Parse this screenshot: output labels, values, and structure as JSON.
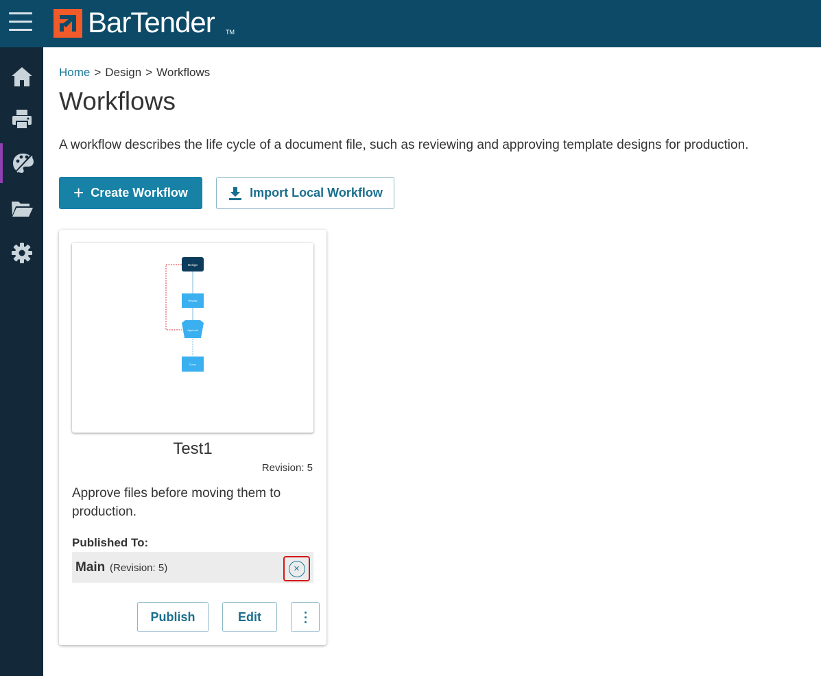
{
  "header": {
    "brand": "BarTender",
    "trademark": "TM",
    "menu_icon": "hamburger-menu-icon"
  },
  "sidebar": {
    "items": [
      {
        "icon": "home-icon",
        "active": false
      },
      {
        "icon": "printer-icon",
        "active": false
      },
      {
        "icon": "design-palette-icon",
        "active": true
      },
      {
        "icon": "folder-icon",
        "active": false
      },
      {
        "icon": "gear-icon",
        "active": false
      }
    ]
  },
  "breadcrumb": {
    "home": "Home",
    "separator": ">",
    "design": "Design",
    "current": "Workflows"
  },
  "page": {
    "title": "Workflows",
    "description": "A workflow describes the life cycle of a document file, such as reviewing and approving template designs for production."
  },
  "actions": {
    "create_label": "Create Workflow",
    "import_label": "Import Local Workflow"
  },
  "workflow_card": {
    "title": "Test1",
    "revision": "Revision: 5",
    "description": "Approve files before moving them to production.",
    "published_label": "Published To:",
    "published_name": "Main",
    "published_revision": "(Revision: 5)",
    "publish_label": "Publish",
    "edit_label": "Edit",
    "diagram": {
      "nodes": [
        "Design",
        "Review",
        "Approval",
        "Done"
      ]
    }
  },
  "colors": {
    "topbar": "#0c4a68",
    "sidebar": "#13293a",
    "accent": "#1781a6",
    "active_nav": "#8e3fb1",
    "highlight": "#d31616"
  }
}
